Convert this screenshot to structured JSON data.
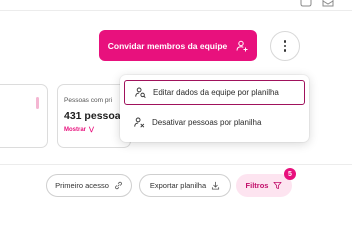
{
  "header": {
    "icons": [
      "message-icon",
      "mail-icon"
    ]
  },
  "actions": {
    "invite_label": "Convidar membros da equipe",
    "invite_icon": "person-add-icon",
    "more_icon": "more-vertical-icon"
  },
  "dropdown_menu": {
    "items": [
      {
        "label": "Editar dados da equipe por planilha",
        "icon": "person-search-icon"
      },
      {
        "label": "Desativar pessoas por planilha",
        "icon": "person-remove-icon"
      }
    ]
  },
  "summary_card": {
    "label": "Pessoas com pri",
    "value": "431 pessoas",
    "link": "Mostrar"
  },
  "filters_bar": {
    "first_access": "Primeiro acesso",
    "export": "Exportar planilha",
    "filters": "Filtros",
    "filters_count": "5"
  },
  "colors": {
    "brand_pink": "#e8117d",
    "selected_border": "#a0125c",
    "filters_bg": "#fde4f0"
  }
}
